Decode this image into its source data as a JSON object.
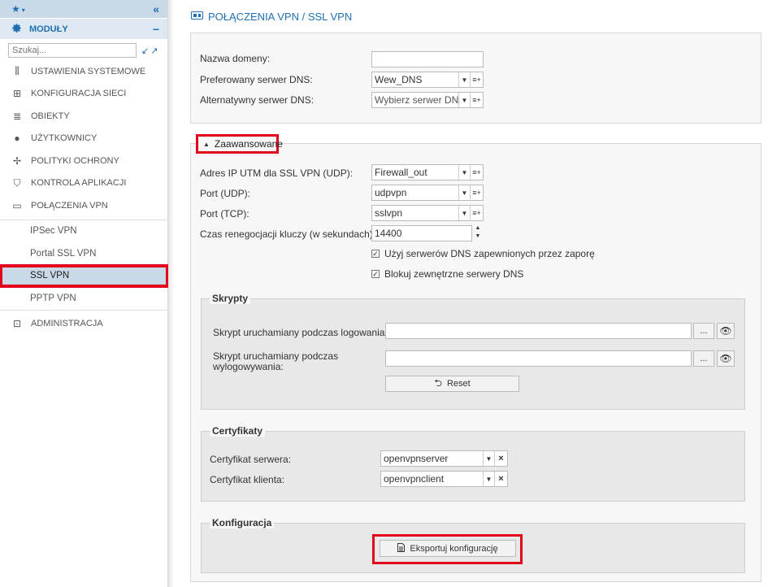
{
  "sidebar": {
    "star": "★",
    "collapse": "«",
    "modules_label": "MODUŁY",
    "modules_minus": "−",
    "search_placeholder": "Szukaj...",
    "items": [
      {
        "label": "USTAWIENIA SYSTEMOWE",
        "icon": "sliders-icon"
      },
      {
        "label": "KONFIGURACJA SIECI",
        "icon": "network-icon"
      },
      {
        "label": "OBIEKTY",
        "icon": "database-icon"
      },
      {
        "label": "UŻYTKOWNICY",
        "icon": "user-icon"
      },
      {
        "label": "POLITYKI OCHRONY",
        "icon": "arrows-icon"
      },
      {
        "label": "KONTROLA APLIKACJI",
        "icon": "shield-icon"
      },
      {
        "label": "POŁĄCZENIA VPN",
        "icon": "vpn-icon"
      }
    ],
    "sub_items": [
      "IPSec VPN",
      "Portal SSL VPN",
      "SSL VPN",
      "PPTP VPN"
    ],
    "admin_label": "ADMINISTRACJA"
  },
  "header": {
    "title": "POŁĄCZENIA VPN / SSL VPN"
  },
  "dns": {
    "domain_label": "Nazwa domeny:",
    "domain_value": "",
    "pref_label": "Preferowany serwer DNS:",
    "pref_value": "Wew_DNS",
    "alt_label": "Alternatywny serwer DNS:",
    "alt_value": "Wybierz serwer DNS"
  },
  "advanced": {
    "toggle_label": "Zaawansowane",
    "ip_label": "Adres IP UTM dla SSL VPN (UDP):",
    "ip_value": "Firewall_out",
    "udp_label": "Port (UDP):",
    "udp_value": "udpvpn",
    "tcp_label": "Port (TCP):",
    "tcp_value": "sslvpn",
    "reneg_label": "Czas renegocjacji kluczy (w sekundach):",
    "reneg_value": "14400",
    "chk1": "Użyj serwerów DNS zapewnionych przez zaporę",
    "chk2": "Blokuj zewnętrzne serwery DNS"
  },
  "scripts": {
    "legend": "Skrypty",
    "login_label": "Skrypt uruchamiany podczas logowania:",
    "logout_label_1": "Skrypt uruchamiany podczas",
    "logout_label_2": "wylogowywania:",
    "dots": "...",
    "reset_label": "Reset"
  },
  "certs": {
    "legend": "Certyfikaty",
    "server_label": "Certyfikat serwera:",
    "server_value": "openvpnserver",
    "client_label": "Certyfikat klienta:",
    "client_value": "openvpnclient"
  },
  "config": {
    "legend": "Konfiguracja",
    "export_label": "Eksportuj konfigurację"
  },
  "colors": {
    "accent": "#1f6fb2",
    "highlight": "#e3001b",
    "active_bg": "#c9d9e8"
  }
}
